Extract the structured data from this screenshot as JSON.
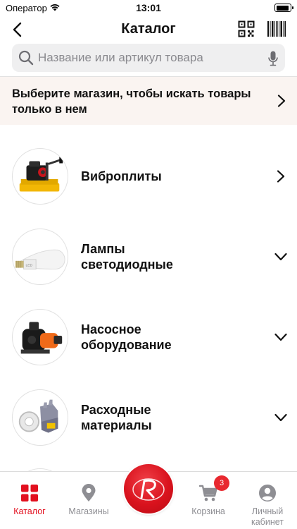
{
  "status_bar": {
    "carrier": "Оператор",
    "time": "13:01"
  },
  "nav": {
    "title": "Каталог"
  },
  "search": {
    "placeholder": "Название или артикул товара",
    "value": ""
  },
  "store_banner": {
    "text": "Выберите магазин, чтобы искать товары только в нем"
  },
  "categories": [
    {
      "lines": [
        "Виброплиты"
      ],
      "chevron": "right",
      "icon": "compactor-image"
    },
    {
      "lines": [
        "Лампы",
        "светодиодные"
      ],
      "chevron": "down",
      "icon": "led-bulb-image"
    },
    {
      "lines": [
        "Насосное",
        "оборудование"
      ],
      "chevron": "down",
      "icon": "water-pump-image"
    },
    {
      "lines": [
        "Расходные",
        "материалы"
      ],
      "chevron": "down",
      "icon": "tape-gloves-image"
    }
  ],
  "tab_bar": {
    "tabs": [
      {
        "label": "Каталог",
        "icon": "grid-icon",
        "active": true
      },
      {
        "label": "Магазины",
        "icon": "map-pin-icon",
        "active": false
      },
      {
        "label": "Корзина",
        "icon": "cart-icon",
        "active": false,
        "badge": "3"
      },
      {
        "label": "Личный кабинет",
        "icon": "profile-icon",
        "active": false
      }
    ]
  },
  "colors": {
    "accent": "#e2101f",
    "banner_bg": "#faf4f1",
    "search_bg": "#efeff0",
    "inactive_tab": "#8e8e93"
  }
}
